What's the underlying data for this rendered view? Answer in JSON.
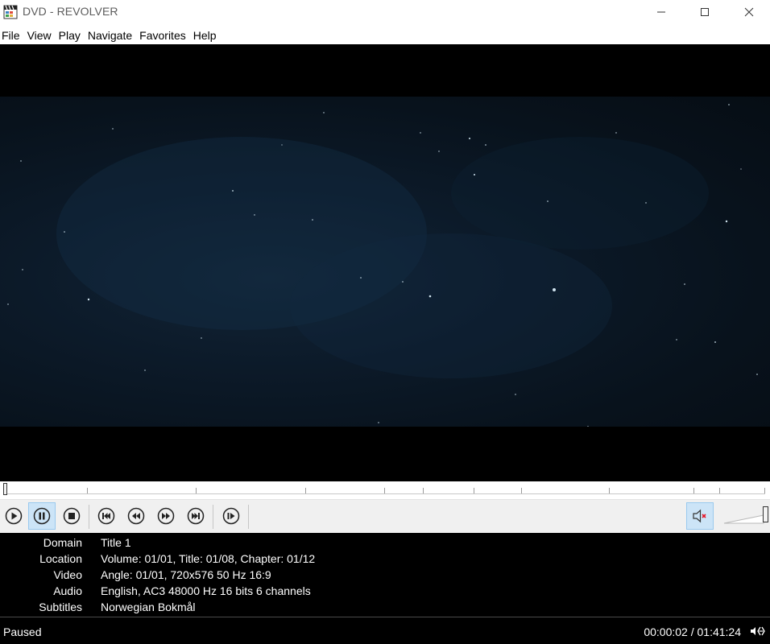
{
  "window": {
    "title": "DVD - REVOLVER",
    "app_icon": "clapperboard-icon",
    "controls": {
      "minimize": "minimize-icon",
      "maximize": "maximize-icon",
      "close": "close-icon"
    }
  },
  "menu": {
    "items": [
      "File",
      "View",
      "Play",
      "Navigate",
      "Favorites",
      "Help"
    ]
  },
  "seek": {
    "position_fraction": 0.0003
  },
  "toolbar": {
    "buttons": [
      {
        "name": "play-button",
        "icon": "play-icon",
        "active": false
      },
      {
        "name": "pause-button",
        "icon": "pause-icon",
        "active": true
      },
      {
        "name": "stop-button",
        "icon": "stop-icon",
        "active": false
      },
      {
        "name": "previous-chapter-button",
        "icon": "skip-back-icon",
        "active": false
      },
      {
        "name": "rewind-button",
        "icon": "rewind-icon",
        "active": false
      },
      {
        "name": "fast-forward-button",
        "icon": "fast-forward-icon",
        "active": false
      },
      {
        "name": "next-chapter-button",
        "icon": "skip-forward-icon",
        "active": false
      },
      {
        "name": "frame-step-button",
        "icon": "frame-step-icon",
        "active": false
      }
    ],
    "mute": {
      "icon": "speaker-muted-icon",
      "active": true
    },
    "volume_level": 1.0
  },
  "info": {
    "rows": [
      {
        "label": "Domain",
        "value": "Title 1"
      },
      {
        "label": "Location",
        "value": "Volume: 01/01, Title: 01/08, Chapter: 01/12"
      },
      {
        "label": "Video",
        "value": "Angle: 01/01, 720x576 50 Hz 16:9"
      },
      {
        "label": "Audio",
        "value": "English, AC3 48000 Hz 16 bits 6 channels"
      },
      {
        "label": "Subtitles",
        "value": "Norwegian Bokmål"
      }
    ]
  },
  "status": {
    "state": "Paused",
    "time": "00:00:02 / 01:41:24",
    "icon": "audio-channels-icon"
  },
  "colors": {
    "video_background": "#000000",
    "toolbar_background": "#f0f0f0",
    "active_button": "#cce4f7",
    "mute_x": "#e81123"
  }
}
